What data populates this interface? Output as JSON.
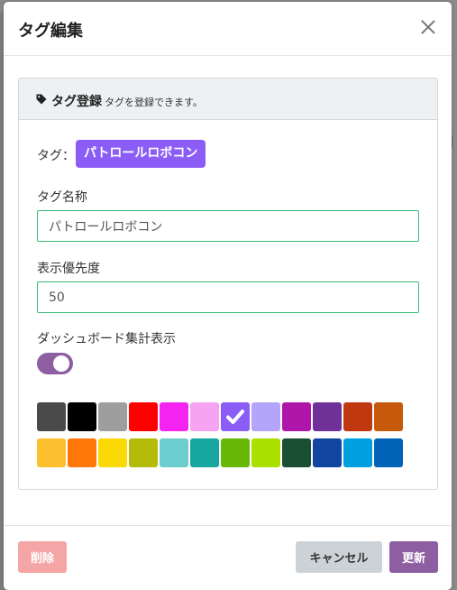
{
  "modal": {
    "title": "タグ編集",
    "card": {
      "title": "タグ登録",
      "subtitle": "タグを登録できます。",
      "tag_prefix": "タグ：",
      "tag_preview": "パトロールロボコン",
      "name_label": "タグ名称",
      "name_value": "パトロールロボコン",
      "priority_label": "表示優先度",
      "priority_value": "50",
      "dashboard_label": "ダッシュボード集計表示",
      "dashboard_enabled": true
    },
    "palette": {
      "selected_index": 6,
      "colors": [
        "#4a4a4a",
        "#000000",
        "#9e9e9e",
        "#ff0000",
        "#f523f2",
        "#f6a4f2",
        "#8b5cf6",
        "#b3a6fa",
        "#ad16a8",
        "#6f3197",
        "#c03810",
        "#c65a0a",
        "#fcc02e",
        "#ff7708",
        "#fbd905",
        "#b5bb0a",
        "#6ccdce",
        "#17a6a0",
        "#67b807",
        "#aadf00",
        "#1a4f33",
        "#1245a0",
        "#00a0e0",
        "#0063b5"
      ]
    },
    "footer": {
      "delete_label": "削除",
      "cancel_label": "キャンセル",
      "update_label": "更新"
    },
    "colors": {
      "accent": "#8e5ea2",
      "tag_chip": "#8b5cf6",
      "input_border": "#3cb878",
      "delete": "#f4a6a6",
      "cancel": "#cdd2d7"
    }
  }
}
